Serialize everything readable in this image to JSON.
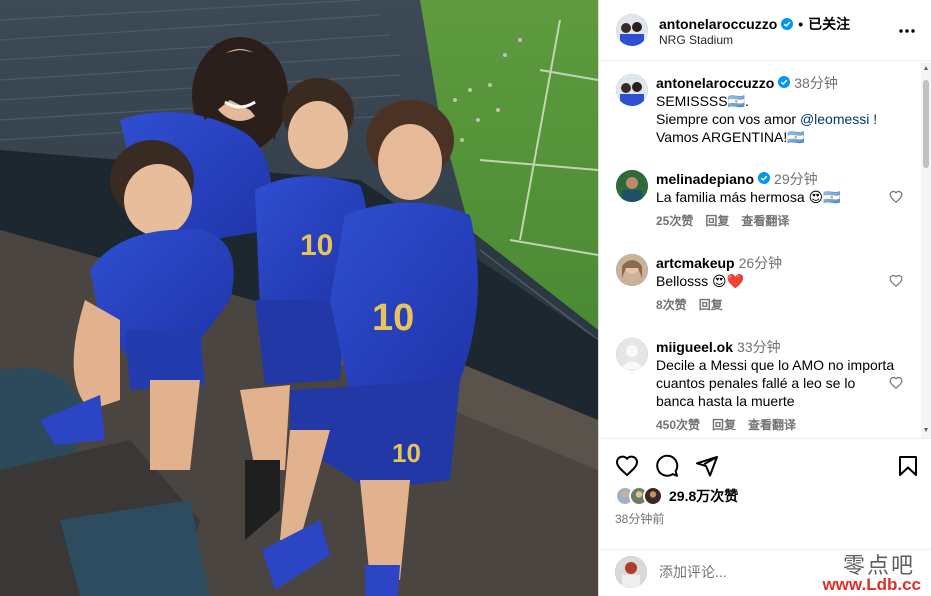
{
  "post": {
    "username": "antonelaroccuzzo",
    "follow_status": "已关注",
    "location": "NRG Stadium"
  },
  "caption": {
    "username": "antonelaroccuzzo",
    "time": "38分钟",
    "line1": "SEMISSSS🇦🇷.",
    "line2_prefix": "Siempre con vos amor ",
    "line2_mention": "@leomessi",
    "line2_suffix": " !",
    "line3": "Vamos ARGENTINA!🇦🇷"
  },
  "comments": [
    {
      "username": "melinadepiano",
      "time": "29分钟",
      "text": "La familia más hermosa 😍🇦🇷",
      "likes": "25次赞",
      "reply": "回复",
      "translate": "查看翻译",
      "avatar_color": "#2f6b3a"
    },
    {
      "username": "artcmakeup",
      "time": "26分钟",
      "text": "Bellosss 😍❤️",
      "likes": "8次赞",
      "reply": "回复",
      "avatar_color": "#c9b29a"
    },
    {
      "username": "miigueel.ok",
      "time": "33分钟",
      "text": "Decile a Messi que lo AMO no importa cuantos penales fallé a leo se lo banca hasta la muerte",
      "likes": "450次赞",
      "reply": "回复",
      "translate": "查看翻译",
      "avatar_color": "#e6e6e6"
    }
  ],
  "actions": {
    "likes_count": "29.8万次赞",
    "post_time": "38分钟前"
  },
  "add_comment": {
    "placeholder": "添加评论..."
  },
  "watermark": {
    "cn": "零点吧",
    "url": "www.Ldb.cc"
  },
  "icons": {
    "verified": "verified-badge-icon",
    "more": "more-options-icon",
    "heart": "heart-icon",
    "comment": "comment-icon",
    "share": "share-icon",
    "save": "bookmark-icon"
  },
  "colors": {
    "verified_blue": "#0095f6",
    "mention": "#00376b",
    "secondary_text": "#737373"
  }
}
